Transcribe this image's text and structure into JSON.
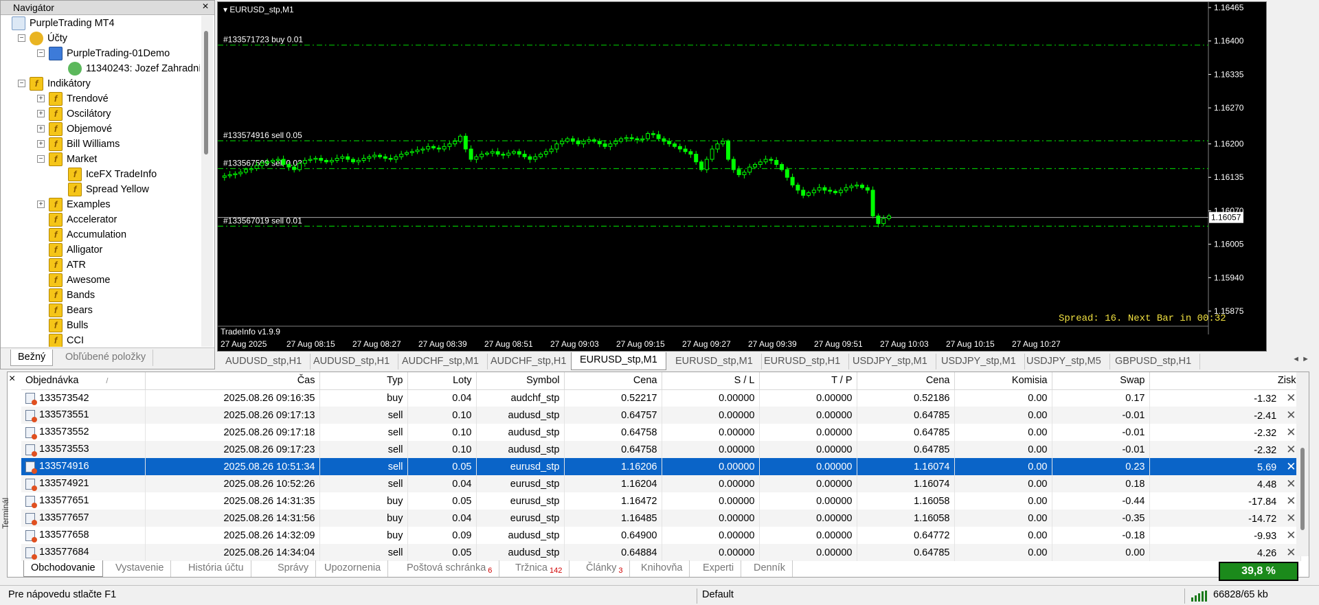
{
  "navigator": {
    "title": "Navigátor",
    "close_label": "×",
    "tree": [
      {
        "label": "PurpleTrading MT4",
        "kind": "mt",
        "level": 0,
        "expander": ""
      },
      {
        "label": "Účty",
        "kind": "acc",
        "level": 1,
        "expander": "−"
      },
      {
        "label": "PurpleTrading-01Demo",
        "kind": "srv",
        "level": 2,
        "expander": "−"
      },
      {
        "label": "11340243: Jozef Zahradník",
        "kind": "usr",
        "level": 3,
        "expander": ""
      },
      {
        "label": "Indikátory",
        "kind": "ind",
        "level": 1,
        "expander": "−"
      },
      {
        "label": "Trendové",
        "kind": "ind",
        "level": 2,
        "expander": "+"
      },
      {
        "label": "Oscilátory",
        "kind": "ind",
        "level": 2,
        "expander": "+"
      },
      {
        "label": "Objemové",
        "kind": "ind",
        "level": 2,
        "expander": "+"
      },
      {
        "label": "Bill Williams",
        "kind": "ind",
        "level": 2,
        "expander": "+"
      },
      {
        "label": "Market",
        "kind": "ind",
        "level": 2,
        "expander": "−"
      },
      {
        "label": "IceFX TradeInfo",
        "kind": "ind",
        "level": 3,
        "expander": ""
      },
      {
        "label": "Spread Yellow",
        "kind": "ind",
        "level": 3,
        "expander": ""
      },
      {
        "label": "Examples",
        "kind": "ind",
        "level": 2,
        "expander": "+"
      },
      {
        "label": "Accelerator",
        "kind": "ind",
        "level": 2,
        "expander": ""
      },
      {
        "label": "Accumulation",
        "kind": "ind",
        "level": 2,
        "expander": ""
      },
      {
        "label": "Alligator",
        "kind": "ind",
        "level": 2,
        "expander": ""
      },
      {
        "label": "ATR",
        "kind": "ind",
        "level": 2,
        "expander": ""
      },
      {
        "label": "Awesome",
        "kind": "ind",
        "level": 2,
        "expander": ""
      },
      {
        "label": "Bands",
        "kind": "ind",
        "level": 2,
        "expander": ""
      },
      {
        "label": "Bears",
        "kind": "ind",
        "level": 2,
        "expander": ""
      },
      {
        "label": "Bulls",
        "kind": "ind",
        "level": 2,
        "expander": ""
      },
      {
        "label": "CCI",
        "kind": "ind",
        "level": 2,
        "expander": ""
      }
    ],
    "tabs": [
      "Bežný",
      "Obľúbené položky"
    ]
  },
  "chart": {
    "title": "EURUSD_stp,M1",
    "price_axis": [
      "1.16465",
      "1.16400",
      "1.16335",
      "1.16270",
      "1.16200",
      "1.16135",
      "1.16070",
      "1.16005",
      "1.15940",
      "1.15875"
    ],
    "current_price": "1.16057",
    "time_axis": [
      "27 Aug 2025",
      "27 Aug 08:15",
      "27 Aug 08:27",
      "27 Aug 08:39",
      "27 Aug 08:51",
      "27 Aug 09:03",
      "27 Aug 09:15",
      "27 Aug 09:27",
      "27 Aug 09:39",
      "27 Aug 09:51",
      "27 Aug 10:03",
      "27 Aug 10:15",
      "27 Aug 10:27"
    ],
    "order_lines": [
      {
        "label": "#133571723 buy 0.01",
        "price": 1.16392
      },
      {
        "label": "#133574916 sell 0.05",
        "price": 1.16206
      },
      {
        "label": "#133567509 sell 0.02",
        "price": 1.16152
      },
      {
        "label": "#133567019 sell 0.01",
        "price": 1.1604
      }
    ],
    "spread_text": "Spread: 16. Next Bar in 00:32",
    "indicator_label": "TradeInfo v1.9.9",
    "colors": {
      "candle": "#00ff00",
      "background": "#000000",
      "order_line": "#00c000",
      "spread": "#f0e040"
    }
  },
  "chart_tabs": {
    "items": [
      "AUDUSD_stp,H1",
      "AUDUSD_stp,H1",
      "AUDCHF_stp,M1",
      "AUDCHF_stp,H1",
      "EURUSD_stp,M1",
      "EURUSD_stp,M1",
      "EURUSD_stp,H1",
      "USDJPY_stp,M1",
      "USDJPY_stp,M1",
      "USDJPY_stp,M5",
      "GBPUSD_stp,H1"
    ],
    "active_index": 4,
    "arrows": "◄ ►"
  },
  "terminal": {
    "close_label": "×",
    "side_label": "Terminál",
    "columns": [
      "Objednávka",
      "Čas",
      "Typ",
      "Loty",
      "Symbol",
      "Cena",
      "S / L",
      "T / P",
      "Cena",
      "Komisia",
      "Swap",
      "Zisk"
    ],
    "sort_marker": "/",
    "rows": [
      [
        "133573542",
        "2025.08.26 09:16:35",
        "buy",
        "0.04",
        "audchf_stp",
        "0.52217",
        "0.00000",
        "0.00000",
        "0.52186",
        "0.00",
        "0.17",
        "-1.32"
      ],
      [
        "133573551",
        "2025.08.26 09:17:13",
        "sell",
        "0.10",
        "audusd_stp",
        "0.64757",
        "0.00000",
        "0.00000",
        "0.64785",
        "0.00",
        "-0.01",
        "-2.41"
      ],
      [
        "133573552",
        "2025.08.26 09:17:18",
        "sell",
        "0.10",
        "audusd_stp",
        "0.64758",
        "0.00000",
        "0.00000",
        "0.64785",
        "0.00",
        "-0.01",
        "-2.32"
      ],
      [
        "133573553",
        "2025.08.26 09:17:23",
        "sell",
        "0.10",
        "audusd_stp",
        "0.64758",
        "0.00000",
        "0.00000",
        "0.64785",
        "0.00",
        "-0.01",
        "-2.32"
      ],
      [
        "133574916",
        "2025.08.26 10:51:34",
        "sell",
        "0.05",
        "eurusd_stp",
        "1.16206",
        "0.00000",
        "0.00000",
        "1.16074",
        "0.00",
        "0.23",
        "5.69"
      ],
      [
        "133574921",
        "2025.08.26 10:52:26",
        "sell",
        "0.04",
        "eurusd_stp",
        "1.16204",
        "0.00000",
        "0.00000",
        "1.16074",
        "0.00",
        "0.18",
        "4.48"
      ],
      [
        "133577651",
        "2025.08.26 14:31:35",
        "buy",
        "0.05",
        "eurusd_stp",
        "1.16472",
        "0.00000",
        "0.00000",
        "1.16058",
        "0.00",
        "-0.44",
        "-17.84"
      ],
      [
        "133577657",
        "2025.08.26 14:31:56",
        "buy",
        "0.04",
        "eurusd_stp",
        "1.16485",
        "0.00000",
        "0.00000",
        "1.16058",
        "0.00",
        "-0.35",
        "-14.72"
      ],
      [
        "133577658",
        "2025.08.26 14:32:09",
        "buy",
        "0.09",
        "audusd_stp",
        "0.64900",
        "0.00000",
        "0.00000",
        "0.64772",
        "0.00",
        "-0.18",
        "-9.93"
      ],
      [
        "133577684",
        "2025.08.26 14:34:04",
        "sell",
        "0.05",
        "audusd_stp",
        "0.64884",
        "0.00000",
        "0.00000",
        "0.64785",
        "0.00",
        "0.00",
        "4.26"
      ]
    ],
    "selected_row": 4,
    "tabs": [
      {
        "label": "Obchodovanie",
        "badge": ""
      },
      {
        "label": "Vystavenie",
        "badge": ""
      },
      {
        "label": "História účtu",
        "badge": ""
      },
      {
        "label": "Správy",
        "badge": ""
      },
      {
        "label": "Upozornenia",
        "badge": ""
      },
      {
        "label": "Poštová schránka",
        "badge": "6"
      },
      {
        "label": "Tržnica",
        "badge": "142"
      },
      {
        "label": "Články",
        "badge": "3"
      },
      {
        "label": "Knihovňa",
        "badge": ""
      },
      {
        "label": "Experti",
        "badge": ""
      },
      {
        "label": "Denník",
        "badge": ""
      }
    ],
    "active_tab": 0,
    "progress_label": "39,8 %"
  },
  "status_bar": {
    "help": "Pre nápovedu stlačte F1",
    "profile": "Default",
    "traffic": "66828/65 kb"
  }
}
